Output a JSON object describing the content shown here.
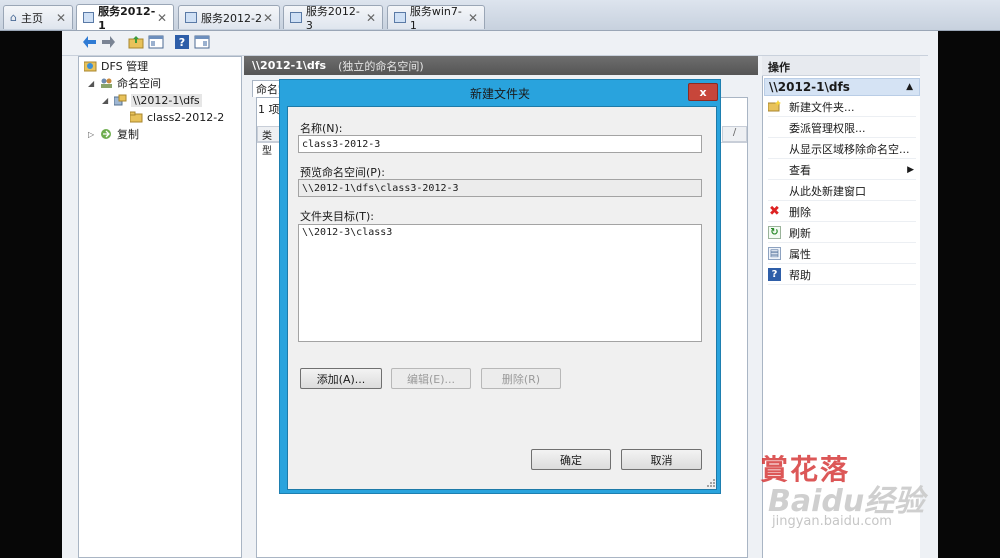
{
  "vm_tabs": [
    {
      "label": "主页"
    },
    {
      "label": "服务2012-1"
    },
    {
      "label": "服务2012-2"
    },
    {
      "label": "服务2012-3"
    },
    {
      "label": "服务win7-1"
    }
  ],
  "tree": {
    "root": "DFS 管理",
    "namespaces": "命名空间",
    "namespace": "\\\\2012-1\\dfs",
    "folder": "class2-2012-2",
    "replication": "复制"
  },
  "center": {
    "header_title": "\\\\2012-1\\dfs",
    "header_subtitle": "(独立的命名空间)",
    "tab_label": "命名空",
    "count_text": "1 项",
    "col_type": "类型"
  },
  "actions": {
    "title": "操作",
    "selected": "\\\\2012-1\\dfs",
    "items": [
      {
        "label": "新建文件夹...",
        "icon": "new-folder-icon"
      },
      {
        "label": "委派管理权限...",
        "icon": ""
      },
      {
        "label": "从显示区域移除命名空...",
        "icon": ""
      },
      {
        "label": "查看",
        "icon": "",
        "submenu": "▶"
      },
      {
        "label": "从此处新建窗口",
        "icon": ""
      },
      {
        "label": "删除",
        "icon": "delete-icon",
        "glyph": "✖"
      },
      {
        "label": "刷新",
        "icon": "refresh-icon",
        "glyph": "↻"
      },
      {
        "label": "属性",
        "icon": "properties-icon",
        "glyph": "▤"
      },
      {
        "label": "帮助",
        "icon": "help-icon",
        "glyph": "?"
      }
    ]
  },
  "dialog": {
    "title": "新建文件夹",
    "close": "x",
    "name_label": "名称(N):",
    "name_value": "class3-2012-3",
    "preview_label": "预览命名空间(P):",
    "preview_value": "\\\\2012-1\\dfs\\class3-2012-3",
    "targets_label": "文件夹目标(T):",
    "targets": [
      "\\\\2012-3\\class3"
    ],
    "add_button": "添加(A)...",
    "edit_button": "编辑(E)...",
    "remove_button": "删除(R)",
    "ok_button": "确定",
    "cancel_button": "取消"
  },
  "watermark": {
    "line1": "賞花落",
    "line2": "Baidu经验",
    "line3": "jingyan.baidu.com"
  },
  "colors": {
    "dialog_frame": "#29a3dd",
    "close_button": "#c7463a",
    "header_bar": "#5f5f5f"
  }
}
